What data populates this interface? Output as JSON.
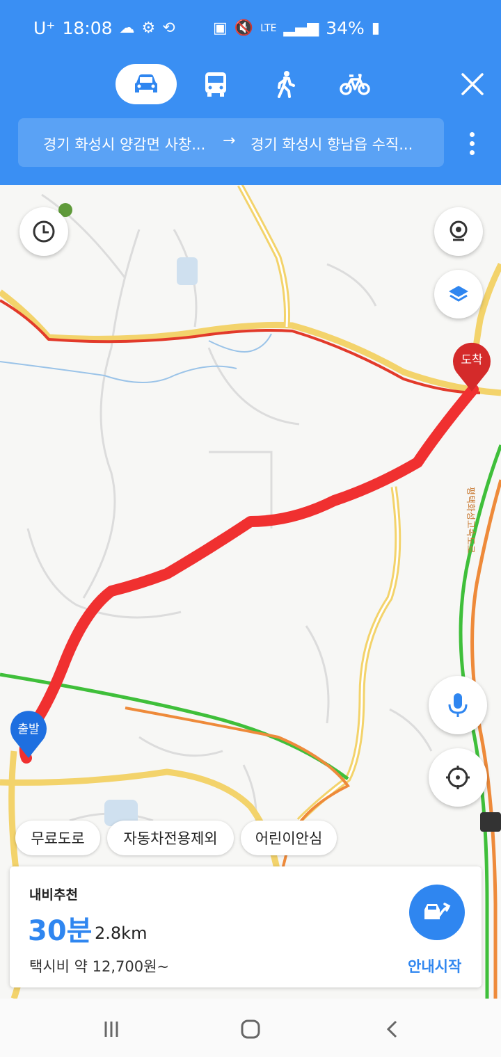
{
  "status_bar": {
    "carrier": "U⁺",
    "time": "18:08",
    "battery": "34%"
  },
  "modes": [
    {
      "name": "car",
      "active": true
    },
    {
      "name": "bus",
      "active": false
    },
    {
      "name": "walk",
      "active": false
    },
    {
      "name": "bike",
      "active": false
    }
  ],
  "route": {
    "from": "경기 화성시 양감면 사창...",
    "arrow": "→",
    "to": "경기 화성시 향남읍 수직..."
  },
  "map": {
    "start_label": "출발",
    "end_label": "도착",
    "road_label": "평택화성고속도로"
  },
  "options": {
    "chip1": "무료도로",
    "chip2": "자동차전용제외",
    "chip3": "어린이안심"
  },
  "summary": {
    "title": "내비추천",
    "time": "30분",
    "distance": "2.8km",
    "fare": "택시비 약 12,700원~",
    "start_label": "안내시작"
  },
  "colors": {
    "accent": "#3a8ff3",
    "route": "#f03030",
    "start_pin": "#1e6fe0",
    "end_pin": "#d42a2a"
  }
}
